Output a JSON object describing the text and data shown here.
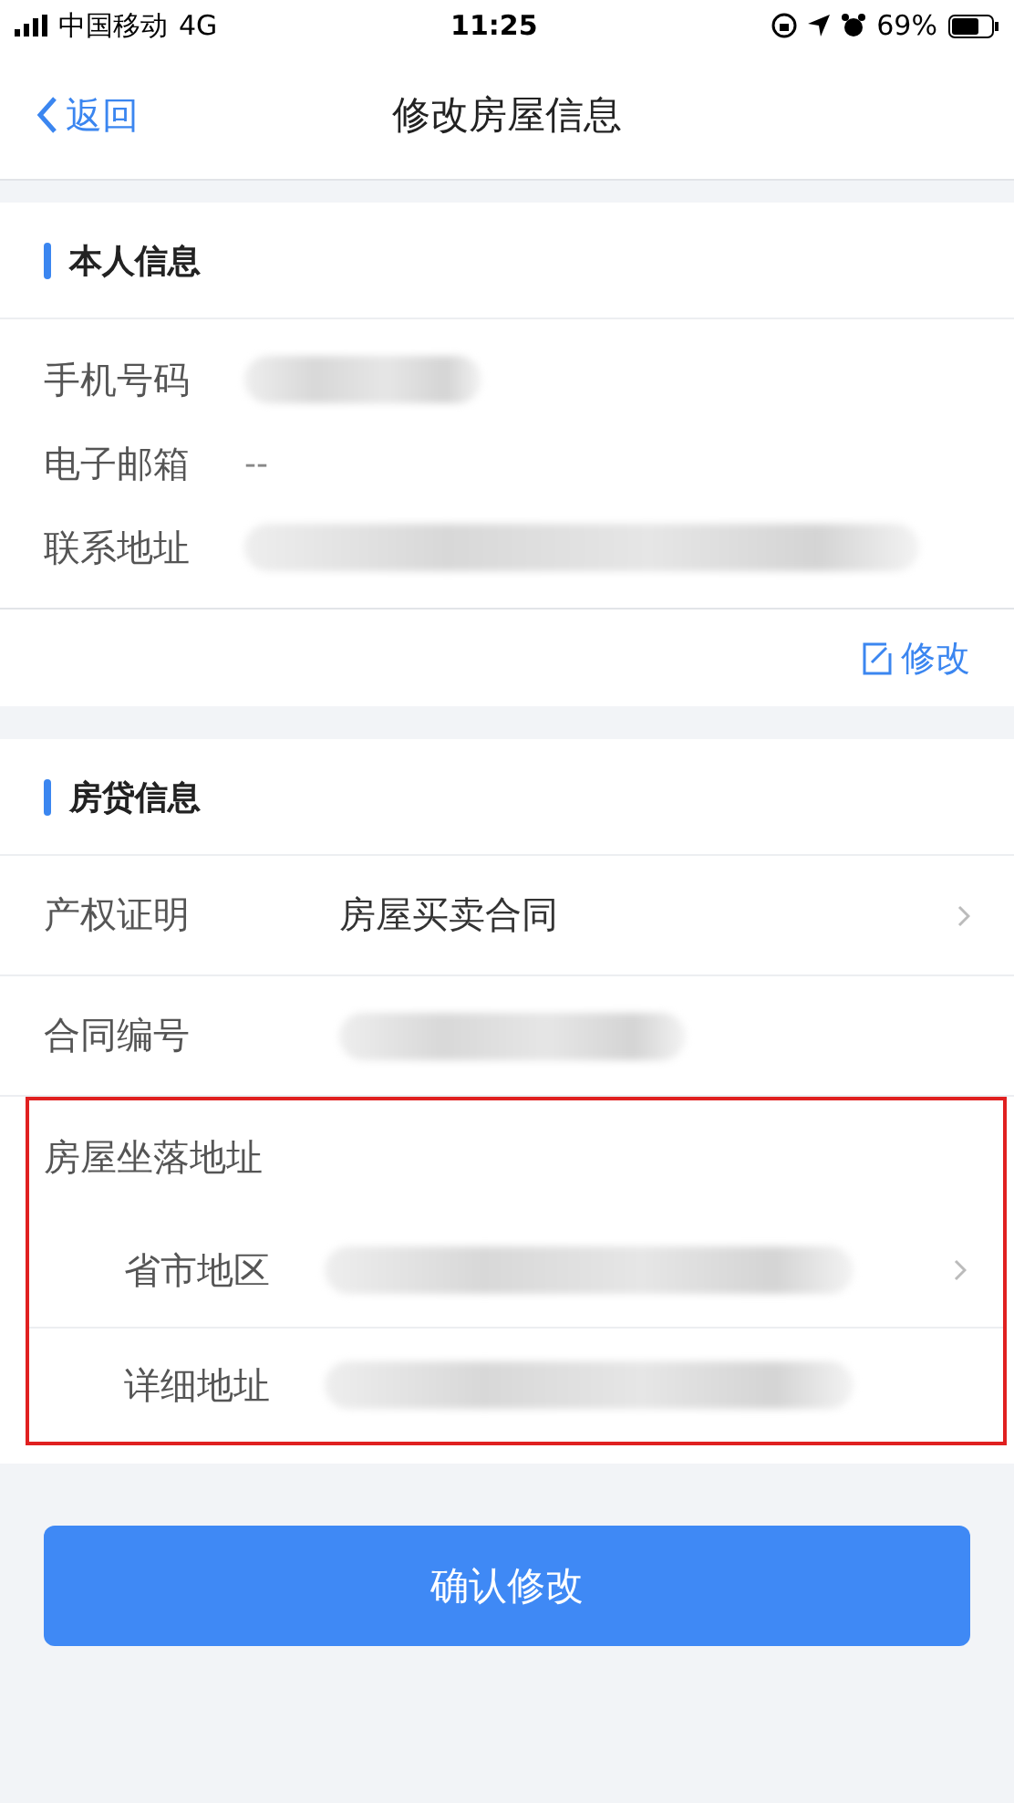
{
  "status_bar": {
    "carrier": "中国移动",
    "network": "4G",
    "time": "11:25",
    "battery": "69%"
  },
  "nav": {
    "back": "返回",
    "title": "修改房屋信息"
  },
  "personal": {
    "title": "本人信息",
    "rows": [
      {
        "label": "手机号码",
        "kind": "blurred"
      },
      {
        "label": "电子邮箱",
        "kind": "text",
        "value": "--"
      },
      {
        "label": "联系地址",
        "kind": "blurred"
      }
    ],
    "edit": "修改"
  },
  "loan": {
    "title": "房贷信息",
    "rows": [
      {
        "label": "产权证明",
        "kind": "select",
        "value": "房屋买卖合同"
      },
      {
        "label": "合同编号",
        "kind": "blurred"
      }
    ],
    "address": {
      "label": "房屋坐落地址",
      "highlighted": true,
      "rows": [
        {
          "label": "省市地区",
          "kind": "blurred-select"
        },
        {
          "label": "详细地址",
          "kind": "blurred"
        }
      ]
    }
  },
  "confirm": "确认修改"
}
